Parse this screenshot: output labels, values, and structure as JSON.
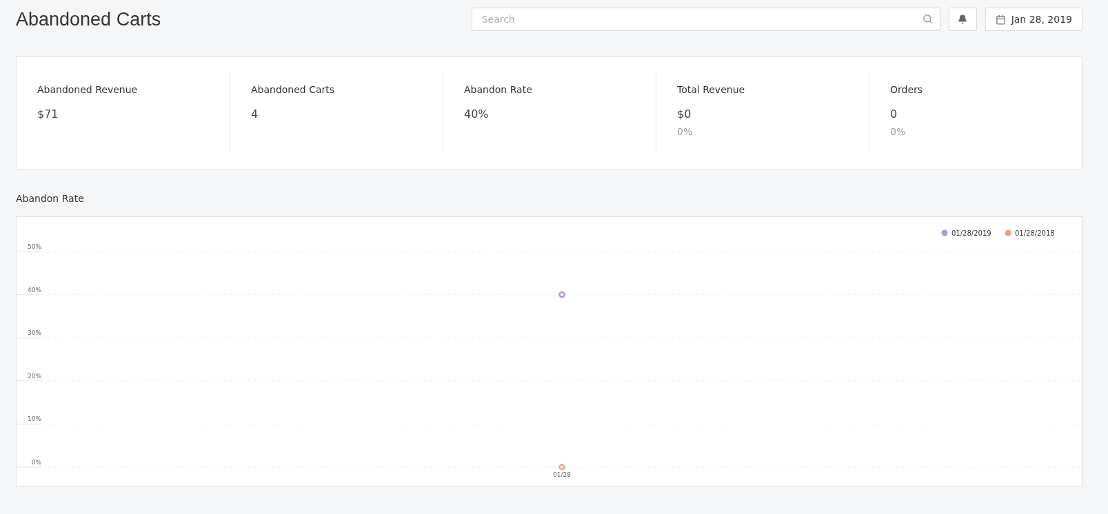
{
  "page_title": "Abandoned Carts",
  "search": {
    "placeholder": "Search"
  },
  "date_button": {
    "label": "Jan 28, 2019"
  },
  "stats": [
    {
      "label": "Abandoned Revenue",
      "value": "$71"
    },
    {
      "label": "Abandoned Carts",
      "value": "4"
    },
    {
      "label": "Abandon Rate",
      "value": "40%"
    },
    {
      "label": "Total Revenue",
      "value": "$0",
      "change": "0%"
    },
    {
      "label": "Orders",
      "value": "0",
      "change": "0%"
    }
  ],
  "chart_section": {
    "title": "Abandon Rate",
    "chart_data": {
      "type": "scatter",
      "x": [
        "01/28"
      ],
      "series": [
        {
          "name": "01/28/2019",
          "color": "#b393e6",
          "values": [
            40
          ]
        },
        {
          "name": "01/28/2018",
          "color": "#f59e85",
          "values": [
            0
          ]
        }
      ],
      "ylim": [
        0,
        50
      ],
      "grid": true,
      "legend": true,
      "yticks": [
        {
          "value": 0,
          "label": "0%"
        },
        {
          "value": 10,
          "label": "10%"
        },
        {
          "value": 20,
          "label": "20%"
        },
        {
          "value": 30,
          "label": "30%"
        },
        {
          "value": 40,
          "label": "40%"
        },
        {
          "value": 50,
          "label": "50%"
        }
      ]
    }
  }
}
